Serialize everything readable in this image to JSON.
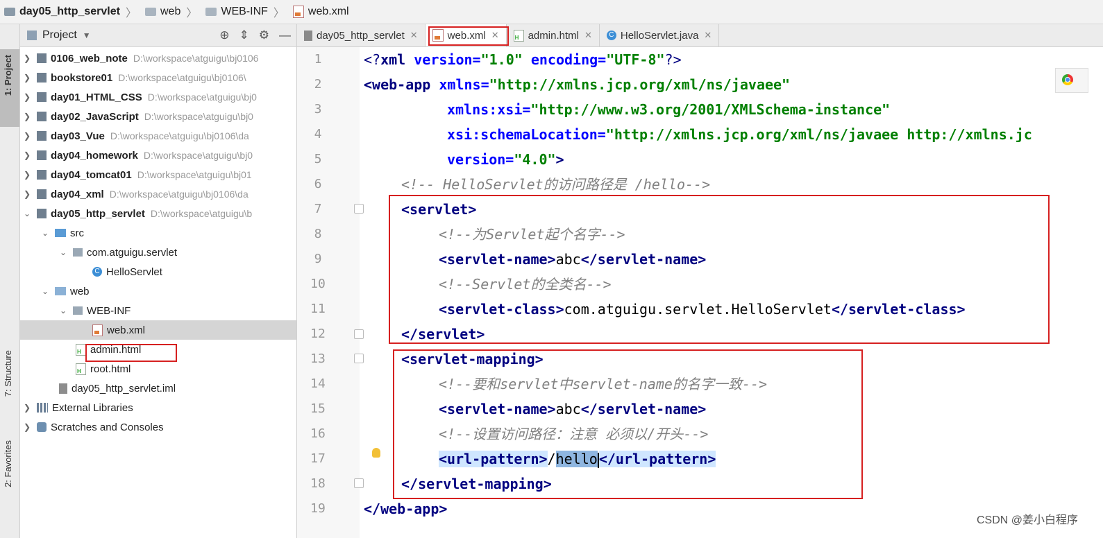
{
  "breadcrumb": {
    "items": [
      "day05_http_servlet",
      "web",
      "WEB-INF",
      "web.xml"
    ]
  },
  "sidebar_tabs": {
    "project": "1: Project",
    "structure": "7: Structure",
    "favorites": "2: Favorites"
  },
  "project_panel": {
    "title": "Project",
    "tree": [
      {
        "label": "0106_web_note",
        "path": "D:\\workspace\\atguigu\\bj0106",
        "type": "module",
        "bold": true
      },
      {
        "label": "bookstore01",
        "path": "D:\\workspace\\atguigu\\bj0106\\",
        "type": "module",
        "bold": true
      },
      {
        "label": "day01_HTML_CSS",
        "path": "D:\\workspace\\atguigu\\bj0",
        "type": "module",
        "bold": true
      },
      {
        "label": "day02_JavaScript",
        "path": "D:\\workspace\\atguigu\\bj0",
        "type": "module",
        "bold": true
      },
      {
        "label": "day03_Vue",
        "path": "D:\\workspace\\atguigu\\bj0106\\da",
        "type": "module",
        "bold": true
      },
      {
        "label": "day04_homework",
        "path": "D:\\workspace\\atguigu\\bj0",
        "type": "module",
        "bold": true
      },
      {
        "label": "day04_tomcat01",
        "path": "D:\\workspace\\atguigu\\bj01",
        "type": "module",
        "bold": true
      },
      {
        "label": "day04_xml",
        "path": "D:\\workspace\\atguigu\\bj0106\\da",
        "type": "module",
        "bold": true
      },
      {
        "label": "day05_http_servlet",
        "path": "D:\\workspace\\atguigu\\b",
        "type": "module",
        "bold": true
      },
      {
        "label": "src",
        "type": "src"
      },
      {
        "label": "com.atguigu.servlet",
        "type": "package"
      },
      {
        "label": "HelloServlet",
        "type": "class"
      },
      {
        "label": "web",
        "type": "web"
      },
      {
        "label": "WEB-INF",
        "type": "folder"
      },
      {
        "label": "web.xml",
        "type": "xml"
      },
      {
        "label": "admin.html",
        "type": "html"
      },
      {
        "label": "root.html",
        "type": "html"
      },
      {
        "label": "day05_http_servlet.iml",
        "type": "iml"
      },
      {
        "label": "External Libraries",
        "type": "lib"
      },
      {
        "label": "Scratches and Consoles",
        "type": "scratch"
      }
    ]
  },
  "editor_tabs": [
    {
      "label": "day05_http_servlet",
      "active": false
    },
    {
      "label": "web.xml",
      "active": true
    },
    {
      "label": "admin.html",
      "active": false
    },
    {
      "label": "HelloServlet.java",
      "active": false
    }
  ],
  "line_numbers": [
    "1",
    "2",
    "3",
    "4",
    "5",
    "6",
    "7",
    "8",
    "9",
    "10",
    "11",
    "12",
    "13",
    "14",
    "15",
    "16",
    "17",
    "18",
    "19"
  ],
  "code": {
    "l1_a": "<?",
    "l1_b": "xml ",
    "l1_c": "version=",
    "l1_d": "\"1.0\"",
    "l1_e": " encoding=",
    "l1_f": "\"UTF-8\"",
    "l1_g": "?>",
    "l2_a": "<web-app ",
    "l2_b": "xmlns=",
    "l2_c": "\"http://xmlns.jcp.org/xml/ns/javaee\"",
    "l3_a": "xmlns:xsi=",
    "l3_b": "\"http://www.w3.org/2001/XMLSchema-instance\"",
    "l4_a": "xsi:schemaLocation=",
    "l4_b": "\"http://xmlns.jcp.org/xml/ns/javaee http://xmlns.jc",
    "l5_a": "version=",
    "l5_b": "\"4.0\"",
    "l5_c": ">",
    "l6": "<!-- HelloServlet的访问路径是 /hello-->",
    "l7": "<servlet>",
    "l8": "<!--为Servlet起个名字-->",
    "l9_a": "<servlet-name>",
    "l9_b": "abc",
    "l9_c": "</servlet-name>",
    "l10": "<!--Servlet的全类名-->",
    "l11_a": "<servlet-class>",
    "l11_b": "com.atguigu.servlet.HelloServlet",
    "l11_c": "</servlet-class>",
    "l12": "</servlet>",
    "l13": "<servlet-mapping>",
    "l14": "<!--要和servlet中servlet-name的名字一致-->",
    "l15_a": "<servlet-name>",
    "l15_b": "abc",
    "l15_c": "</servlet-name>",
    "l16": "<!--设置访问路径：注意 必须以/开头-->",
    "l17_a": "<url-pattern>",
    "l17_b": "/",
    "l17_c": "hello",
    "l17_d": "</url-pattern>",
    "l18": "</servlet-mapping>",
    "l19": "</web-app>"
  },
  "watermark": "CSDN @姜小白程序",
  "colors": {
    "tag": "#000080",
    "attribute": "#0000ff",
    "string": "#008000",
    "comment": "#808080",
    "annotation_box": "#d62020"
  }
}
